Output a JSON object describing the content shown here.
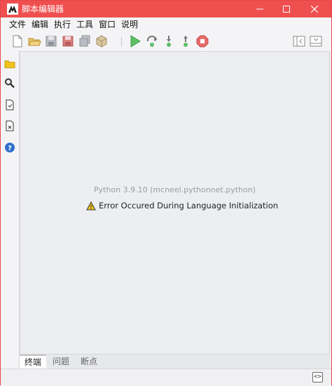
{
  "window": {
    "title": "脚本编辑器",
    "accent_color": "#f04f4f",
    "controls": [
      "minimize-icon",
      "maximize-icon",
      "close-icon"
    ]
  },
  "menubar": {
    "items": [
      {
        "label": "文件"
      },
      {
        "label": "编辑"
      },
      {
        "label": "执行"
      },
      {
        "label": "工具"
      },
      {
        "label": "窗口"
      },
      {
        "label": "说明"
      }
    ]
  },
  "toolbar": {
    "icons": [
      "new-file-icon",
      "open-folder-icon",
      "save-icon",
      "save-as-icon",
      "save-all-icon",
      "package-icon",
      "run-icon",
      "step-over-icon",
      "step-into-icon",
      "step-out-icon",
      "stop-icon",
      "collapse-left-icon",
      "collapse-bottom-icon"
    ]
  },
  "sidebar": {
    "icons": [
      "folder-icon",
      "search-icon",
      "script-file-icon",
      "script-doc-icon",
      "help-icon"
    ]
  },
  "editor": {
    "python_version": "Python 3.9.10 (mcneel.pythonnet.python)",
    "error_message": "Error Occured During Language Initialization",
    "warning_color": "#f2c31b"
  },
  "bottom_tabs": [
    {
      "label": "终端",
      "active": true
    },
    {
      "label": "问题",
      "active": false
    },
    {
      "label": "断点",
      "active": false
    }
  ],
  "statusbar": {
    "toggle_label": "<>"
  }
}
